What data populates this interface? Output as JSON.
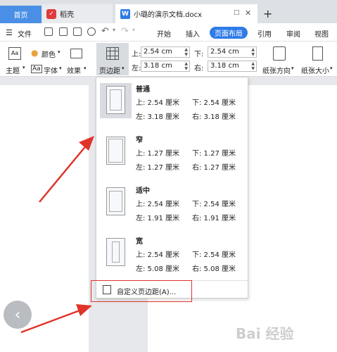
{
  "tabs": {
    "home": "首页",
    "daoke": "稻壳",
    "doc": "小璐的演示文档.docx",
    "daoke_icon": "daoke-logo-icon",
    "doc_icon": "wps-writer-icon"
  },
  "menu": {
    "file": "文件",
    "items": [
      "开始",
      "插入",
      "页面布局",
      "引用",
      "审阅",
      "视图"
    ],
    "active": "页面布局"
  },
  "ribbon": {
    "theme": "主题",
    "color": "颜色",
    "font": "字体",
    "effect": "效果",
    "margins": "页边距",
    "top_label": "上:",
    "top_value": "2.54 cm",
    "bottom_label": "下:",
    "bottom_value": "2.54 cm",
    "left_label": "左:",
    "left_value": "3.18 cm",
    "right_label": "右:",
    "right_value": "3.18 cm",
    "orientation": "纸张方向",
    "size": "纸张大小"
  },
  "margin_presets": [
    {
      "name": "普通",
      "top": "上: 2.54 厘米",
      "bottom": "下: 2.54 厘米",
      "left": "左: 3.18 厘米",
      "right": "右: 3.18 厘米",
      "selected": true
    },
    {
      "name": "窄",
      "top": "上: 1.27 厘米",
      "bottom": "下: 1.27 厘米",
      "left": "左: 1.27 厘米",
      "right": "右: 1.27 厘米",
      "selected": false
    },
    {
      "name": "适中",
      "top": "上: 2.54 厘米",
      "bottom": "下: 2.54 厘米",
      "left": "左: 1.91 厘米",
      "right": "右: 1.91 厘米",
      "selected": false
    },
    {
      "name": "宽",
      "top": "上: 2.54 厘米",
      "bottom": "下: 2.54 厘米",
      "left": "左: 5.08 厘米",
      "right": "右: 5.08 厘米",
      "selected": false
    }
  ],
  "custom_margins": "自定义页边距(A)...",
  "watermark": "Bai 经验",
  "colors": {
    "accent": "#2f7ce8",
    "annotation": "#e0342b"
  }
}
